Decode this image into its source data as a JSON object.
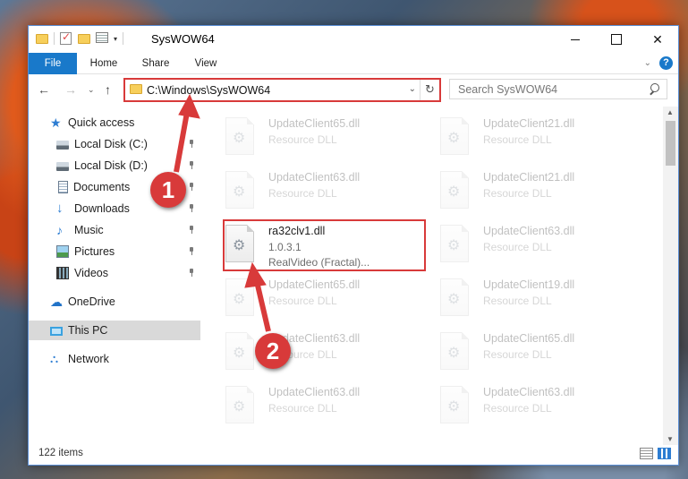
{
  "window": {
    "title": "SysWOW64",
    "close_glyph": "✕"
  },
  "quick_access_toolbar": {
    "icons": [
      "folder-icon",
      "properties-check-icon",
      "new-folder-icon",
      "customize-icon"
    ],
    "dropdown_glyph": "▾"
  },
  "ribbon": {
    "tabs": [
      "File",
      "Home",
      "Share",
      "View"
    ],
    "expand_glyph": "⌄",
    "help_glyph": "?"
  },
  "nav": {
    "back_glyph": "←",
    "forward_glyph": "→",
    "recent_glyph": "⌄",
    "up_glyph": "↑"
  },
  "address": {
    "path": "C:\\Windows\\SysWOW64",
    "dropdown_glyph": "⌄",
    "refresh_glyph": "↻"
  },
  "search": {
    "placeholder": "Search SysWOW64"
  },
  "sidebar": {
    "items": [
      {
        "label": "Quick access",
        "icon": "star-icon",
        "pinned": false
      },
      {
        "label": "Local Disk (C:)",
        "icon": "drive-icon",
        "pinned": true
      },
      {
        "label": "Local Disk (D:)",
        "icon": "drive-icon",
        "pinned": true
      },
      {
        "label": "Documents",
        "icon": "document-icon",
        "pinned": true
      },
      {
        "label": "Downloads",
        "icon": "download-icon",
        "pinned": true
      },
      {
        "label": "Music",
        "icon": "music-icon",
        "pinned": true
      },
      {
        "label": "Pictures",
        "icon": "pictures-icon",
        "pinned": true
      },
      {
        "label": "Videos",
        "icon": "videos-icon",
        "pinned": true
      },
      {
        "label": "OneDrive",
        "icon": "cloud-icon",
        "pinned": false
      },
      {
        "label": "This PC",
        "icon": "pc-icon",
        "pinned": false,
        "selected": true
      },
      {
        "label": "Network",
        "icon": "network-icon",
        "pinned": false
      }
    ]
  },
  "files": [
    {
      "name": "UpdateClient65.dll",
      "line2": "Resource DLL",
      "line3": ""
    },
    {
      "name": "UpdateClient21.dll",
      "line2": "Resource DLL",
      "line3": ""
    },
    {
      "name": "UpdateClient63.dll",
      "line2": "Resource DLL",
      "line3": ""
    },
    {
      "name": "UpdateClient21.dll",
      "line2": "Resource DLL",
      "line3": ""
    },
    {
      "name": "ra32clv1.dll",
      "line2": "1.0.3.1",
      "line3": "RealVideo (Fractal)...",
      "highlighted": true
    },
    {
      "name": "UpdateClient63.dll",
      "line2": "Resource DLL",
      "line3": ""
    },
    {
      "name": "UpdateClient65.dll",
      "line2": "Resource DLL",
      "line3": ""
    },
    {
      "name": "UpdateClient19.dll",
      "line2": "Resource DLL",
      "line3": ""
    },
    {
      "name": "UpdateClient63.dll",
      "line2": "Resource DLL",
      "line3": ""
    },
    {
      "name": "UpdateClient65.dll",
      "line2": "Resource DLL",
      "line3": ""
    },
    {
      "name": "UpdateClient63.dll",
      "line2": "Resource DLL",
      "line3": ""
    },
    {
      "name": "UpdateClient63.dll",
      "line2": "Resource DLL",
      "line3": ""
    }
  ],
  "scrollbar": {
    "up_glyph": "▲",
    "down_glyph": "▼"
  },
  "status": {
    "item_count": "122 items"
  },
  "annotations": {
    "step1": "1",
    "step2": "2",
    "color": "#d83a3a"
  }
}
